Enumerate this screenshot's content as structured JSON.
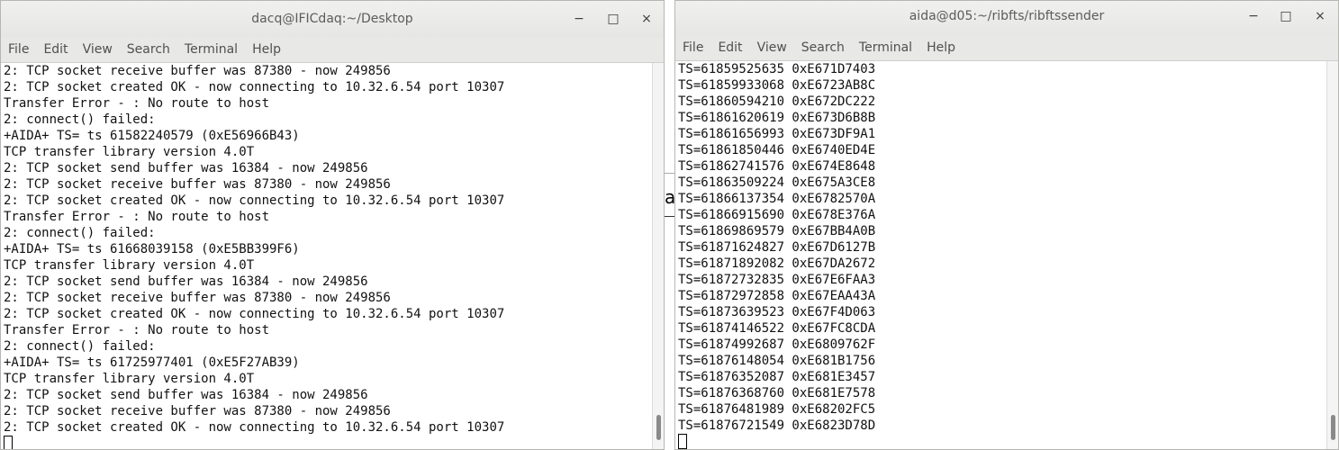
{
  "left_window": {
    "title": "dacq@IFICdaq:~/Desktop",
    "menu": [
      "File",
      "Edit",
      "View",
      "Search",
      "Terminal",
      "Help"
    ],
    "lines": [
      "2: TCP socket receive buffer was 87380 - now 249856",
      "2: TCP socket created OK - now connecting to 10.32.6.54 port 10307",
      "Transfer Error - : No route to host",
      "2: connect() failed:",
      "+AIDA+ TS= ts 61582240579 (0xE56966B43)",
      "TCP transfer library version 4.0T",
      "2: TCP socket send buffer was 16384 - now 249856",
      "2: TCP socket receive buffer was 87380 - now 249856",
      "2: TCP socket created OK - now connecting to 10.32.6.54 port 10307",
      "Transfer Error - : No route to host",
      "2: connect() failed:",
      "+AIDA+ TS= ts 61668039158 (0xE5BB399F6)",
      "TCP transfer library version 4.0T",
      "2: TCP socket send buffer was 16384 - now 249856",
      "2: TCP socket receive buffer was 87380 - now 249856",
      "2: TCP socket created OK - now connecting to 10.32.6.54 port 10307",
      "Transfer Error - : No route to host",
      "2: connect() failed:",
      "+AIDA+ TS= ts 61725977401 (0xE5F27AB39)",
      "TCP transfer library version 4.0T",
      "2: TCP socket send buffer was 16384 - now 249856",
      "2: TCP socket receive buffer was 87380 - now 249856",
      "2: TCP socket created OK - now connecting to 10.32.6.54 port 10307"
    ]
  },
  "right_window": {
    "title": "aida@d05:~/ribfts/ribftssender",
    "menu": [
      "File",
      "Edit",
      "View",
      "Search",
      "Terminal",
      "Help"
    ],
    "lines": [
      "TS=61859525635 0xE671D7403",
      "TS=61859933068 0xE6723AB8C",
      "TS=61860594210 0xE672DC222",
      "TS=61861620619 0xE673D6B8B",
      "TS=61861656993 0xE673DF9A1",
      "TS=61861850446 0xE6740ED4E",
      "TS=61862741576 0xE674E8648",
      "TS=61863509224 0xE675A3CE8",
      "TS=61866137354 0xE6782570A",
      "TS=61866915690 0xE678E376A",
      "TS=61869869579 0xE67BB4A0B",
      "TS=61871624827 0xE67D6127B",
      "TS=61871892082 0xE67DA2672",
      "TS=61872732835 0xE67E6FAA3",
      "TS=61872972858 0xE67EAA43A",
      "TS=61873639523 0xE67F4D063",
      "TS=61874146522 0xE67FC8CDA",
      "TS=61874992687 0xE6809762F",
      "TS=61876148054 0xE681B1756",
      "TS=61876352087 0xE681E3457",
      "TS=61876368760 0xE681E7578",
      "TS=61876481989 0xE68202FC5",
      "TS=61876721549 0xE6823D78D"
    ]
  },
  "controls": {
    "minimize": "−",
    "maximize": "□",
    "close": "×"
  },
  "background_glyph": "ati"
}
